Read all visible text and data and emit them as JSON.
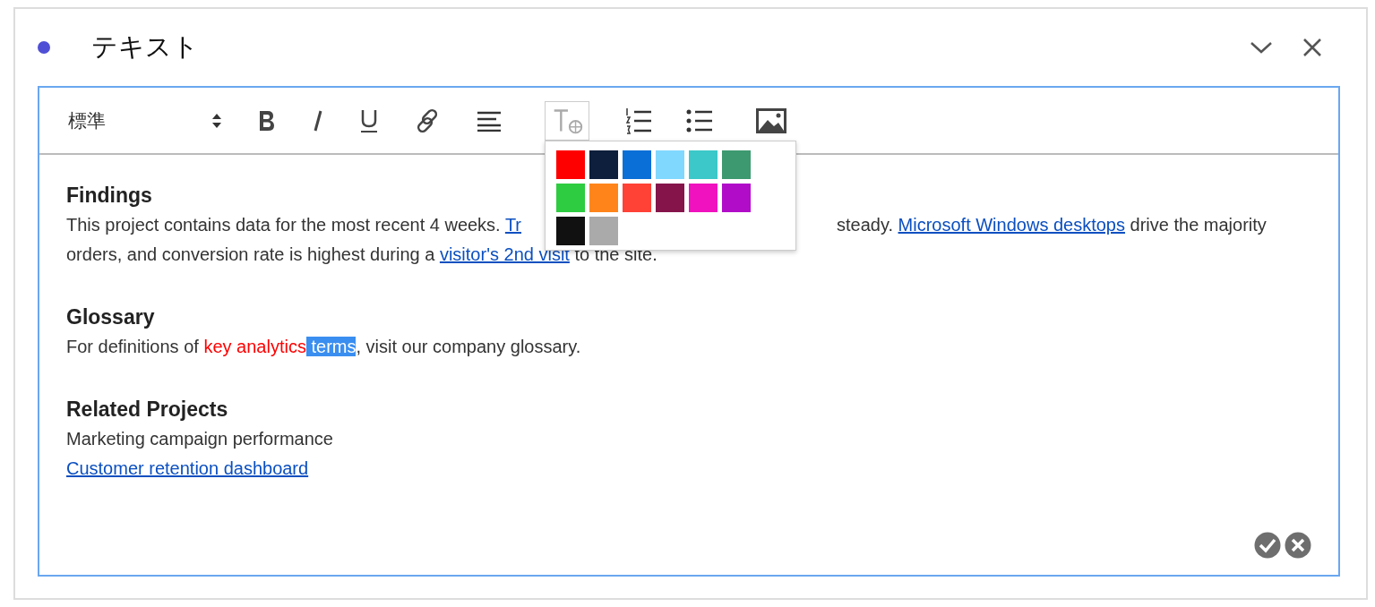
{
  "panel": {
    "title": "テキスト"
  },
  "toolbar": {
    "style_select": "標準",
    "color_menu_open": true
  },
  "color_menu": {
    "colors": [
      {
        "color": "#ff0000"
      },
      {
        "color": "#0d1f3c"
      },
      {
        "color": "#0a6fd6"
      },
      {
        "color": "#80d8ff"
      },
      {
        "color": "#3cc8c8"
      },
      {
        "color": "#3d9970"
      },
      {
        "color": "#2ecc40"
      },
      {
        "color": "#ff851b"
      },
      {
        "color": "#ff4136"
      },
      {
        "color": "#85144b"
      },
      {
        "color": "#f012be"
      },
      {
        "color": "#b10dc9"
      },
      {
        "color": "#111111"
      },
      {
        "color": "#aaaaaa"
      }
    ]
  },
  "sections": [
    {
      "heading": "Findings",
      "lines": [
        {
          "left": [
            {
              "kind": "plain",
              "text": "This project contains data for the most recent 4 weeks. "
            },
            {
              "kind": "link",
              "text": "Tr"
            }
          ],
          "right": [
            {
              "kind": "plain",
              "text": "steady. "
            },
            {
              "kind": "link",
              "text": "Microsoft Windows desktops"
            },
            {
              "kind": "plain",
              "text": " drive the majority"
            }
          ]
        },
        {
          "left": [
            {
              "kind": "plain",
              "text": "orders, and conversion rate is highest during a "
            },
            {
              "kind": "link",
              "text": "visitor's 2nd visit"
            },
            {
              "kind": "plain",
              "text": " to the site."
            }
          ]
        }
      ]
    },
    {
      "heading": "Glossary",
      "lines": [
        {
          "left": [
            {
              "kind": "plain",
              "text": "For definitions of "
            },
            {
              "kind": "colored",
              "color": "#ff0000",
              "text": "key analytics"
            },
            {
              "kind": "highlighted",
              "text": " terms"
            },
            {
              "kind": "plain",
              "text": ", visit our company glossary."
            }
          ]
        }
      ]
    },
    {
      "heading": "Related Projects",
      "lines": [
        {
          "left": [
            {
              "kind": "plain",
              "text": "Marketing campaign performance"
            }
          ]
        },
        {
          "left": [
            {
              "kind": "link",
              "text": "Customer retention dashboard"
            }
          ]
        }
      ]
    }
  ]
}
